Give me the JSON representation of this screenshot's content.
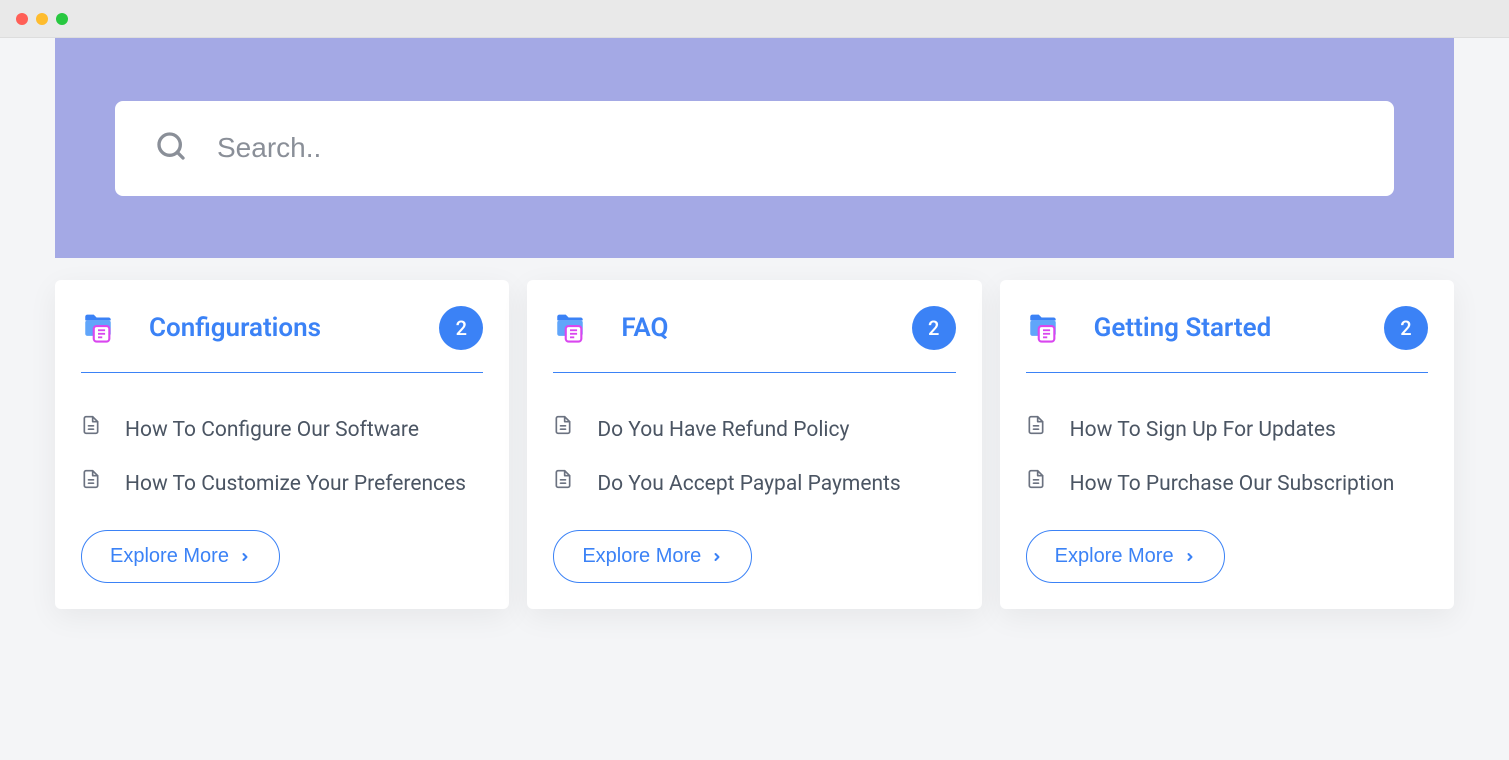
{
  "search": {
    "placeholder": "Search.."
  },
  "cards": [
    {
      "title": "Configurations",
      "badge": "2",
      "articles": [
        "How To Configure Our Software",
        "How To Customize Your Preferences"
      ],
      "explore_label": "Explore More"
    },
    {
      "title": "FAQ",
      "badge": "2",
      "articles": [
        "Do You Have Refund Policy",
        "Do You Accept Paypal Payments"
      ],
      "explore_label": "Explore More"
    },
    {
      "title": "Getting Started",
      "badge": "2",
      "articles": [
        "How To Sign Up For Updates",
        "How To Purchase Our Subscription"
      ],
      "explore_label": "Explore More"
    }
  ]
}
